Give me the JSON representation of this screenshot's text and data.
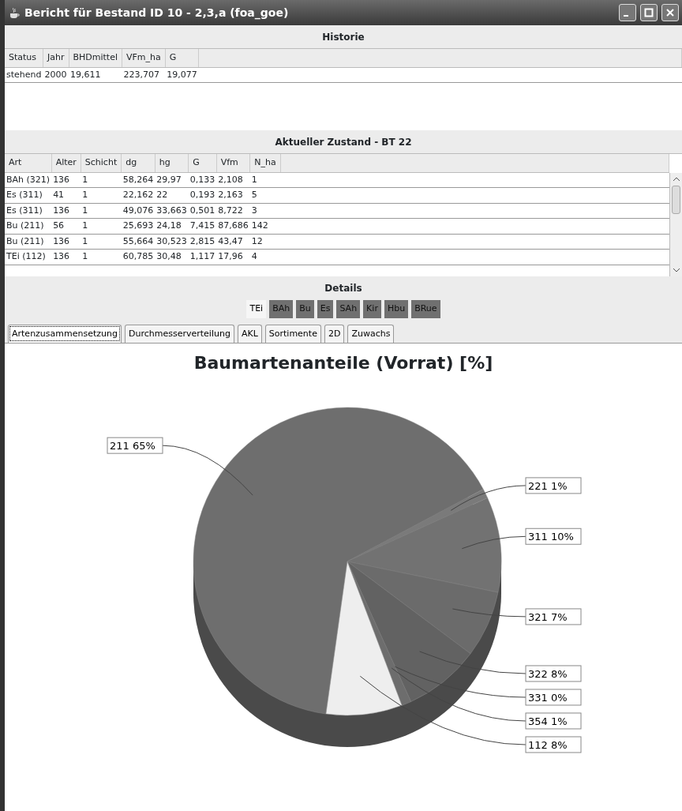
{
  "window": {
    "title": "Bericht für Bestand ID 10 - 2,3,a (foa_goe)"
  },
  "historie": {
    "title": "Historie",
    "columns": [
      "Status",
      "Jahr",
      "BHDmittel",
      "VFm_ha",
      "G"
    ],
    "rows": [
      [
        "stehend",
        "2000",
        "19,611",
        "223,707",
        "19,077"
      ]
    ]
  },
  "zustand": {
    "title": "Aktueller Zustand - BT 22",
    "columns": [
      "Art",
      "Alter",
      "Schicht",
      "dg",
      "hg",
      "G",
      "Vfm",
      "N_ha"
    ],
    "rows": [
      [
        "BAh (321)",
        "136",
        "1",
        "58,264",
        "29,97",
        "0,133",
        "2,108",
        "1"
      ],
      [
        "Es (311)",
        "41",
        "1",
        "22,162",
        "22",
        "0,193",
        "2,163",
        "5"
      ],
      [
        "Es (311)",
        "136",
        "1",
        "49,076",
        "33,663",
        "0,501",
        "8,722",
        "3"
      ],
      [
        "Bu (211)",
        "56",
        "1",
        "25,693",
        "24,18",
        "7,415",
        "87,686",
        "142"
      ],
      [
        "Bu (211)",
        "136",
        "1",
        "55,664",
        "30,523",
        "2,815",
        "43,47",
        "12"
      ],
      [
        "TEi (112)",
        "136",
        "1",
        "60,785",
        "30,48",
        "1,117",
        "17,96",
        "4"
      ]
    ]
  },
  "details": {
    "title": "Details",
    "species": [
      {
        "label": "TEi",
        "selected": true
      },
      {
        "label": "BAh",
        "selected": false
      },
      {
        "label": "Bu",
        "selected": false
      },
      {
        "label": "Es",
        "selected": false
      },
      {
        "label": "SAh",
        "selected": false
      },
      {
        "label": "Kir",
        "selected": false
      },
      {
        "label": "Hbu",
        "selected": false
      },
      {
        "label": "BRue",
        "selected": false
      }
    ],
    "tabs": [
      {
        "label": "Artenzusammensetzung",
        "selected": true
      },
      {
        "label": "Durchmesserverteilung",
        "selected": false
      },
      {
        "label": "AKL",
        "selected": false
      },
      {
        "label": "Sortimente",
        "selected": false
      },
      {
        "label": "2D",
        "selected": false
      },
      {
        "label": "Zuwachs",
        "selected": false
      }
    ],
    "chart_data": {
      "type": "pie",
      "title": "Baumartenanteile (Vorrat) [%]",
      "categories": [
        "211 65%",
        "221 1%",
        "311 10%",
        "321 7%",
        "322 8%",
        "331 0%",
        "354 1%",
        "112 8%"
      ],
      "values": [
        65,
        1,
        10,
        7,
        8,
        0,
        1,
        8
      ]
    }
  }
}
